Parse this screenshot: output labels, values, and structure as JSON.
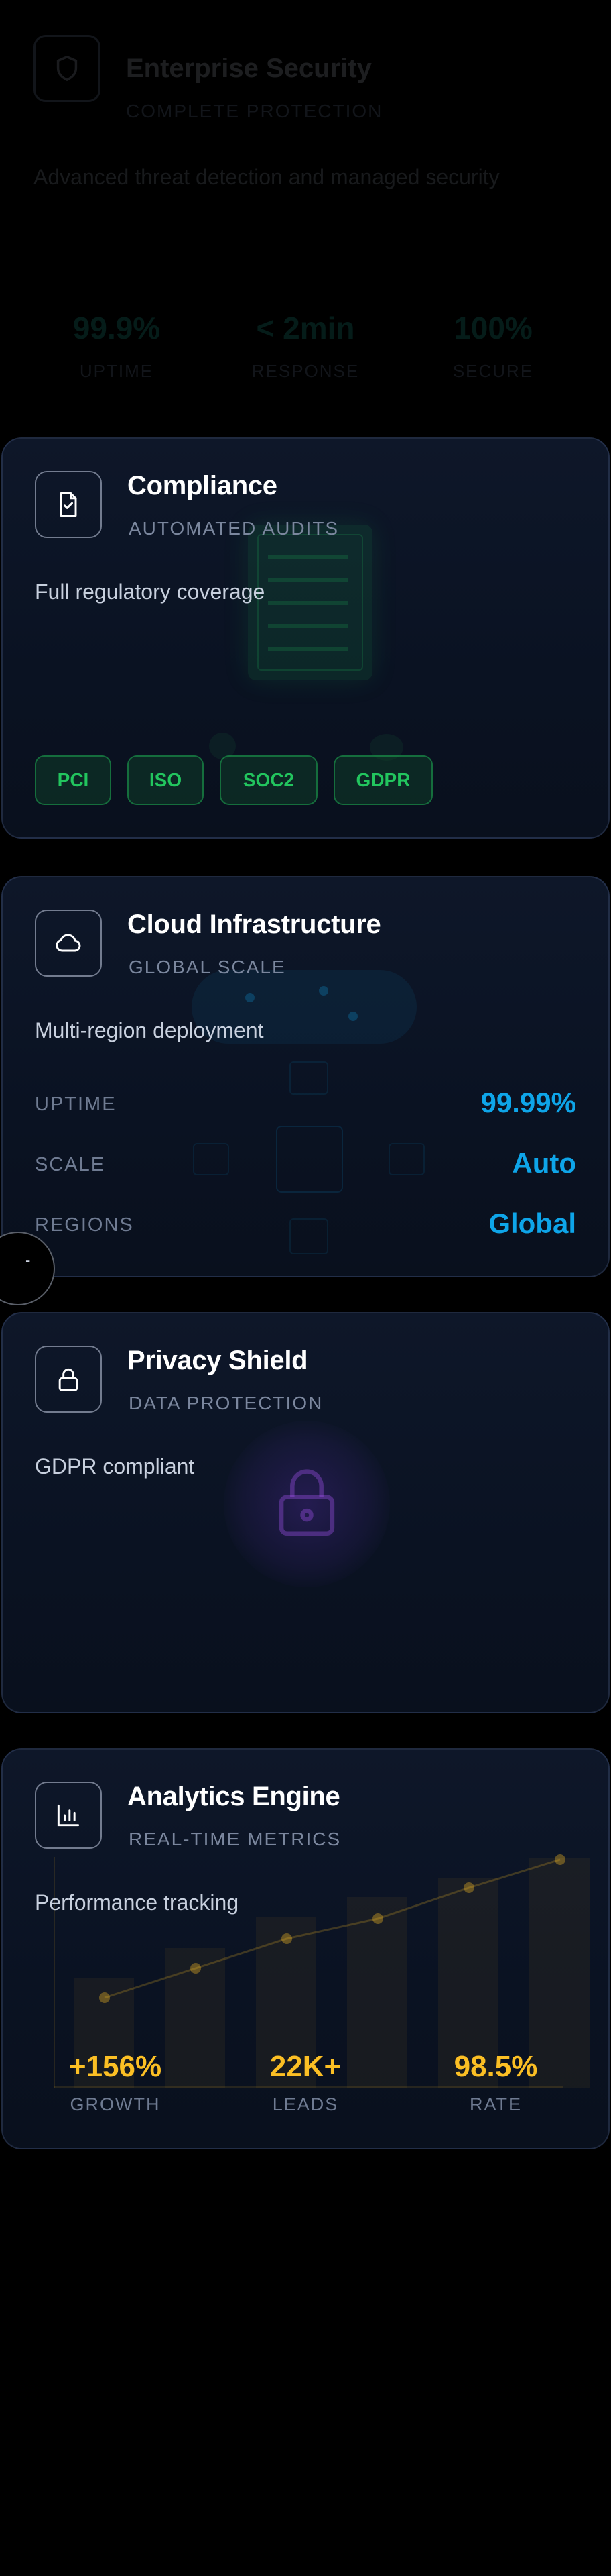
{
  "hidden_card": {
    "title": "Enterprise Security",
    "subtitle": "COMPLETE PROTECTION",
    "description": "Advanced threat detection and managed security",
    "stats": [
      {
        "value": "99.9%",
        "label": "UPTIME"
      },
      {
        "value": "< 2min",
        "label": "RESPONSE"
      },
      {
        "value": "100%",
        "label": "SECURE"
      }
    ]
  },
  "compliance": {
    "title": "Compliance",
    "subtitle": "AUTOMATED AUDITS",
    "description": "Full regulatory coverage",
    "tags": [
      "PCI",
      "ISO",
      "SOC2",
      "GDPR"
    ],
    "icon": "file-check-icon",
    "accent": "#22c55e"
  },
  "cloud": {
    "title": "Cloud Infrastructure",
    "subtitle": "GLOBAL SCALE",
    "description": "Multi-region deployment",
    "metrics": [
      {
        "label": "UPTIME",
        "value": "99.99%"
      },
      {
        "label": "SCALE",
        "value": "Auto"
      },
      {
        "label": "REGIONS",
        "value": "Global"
      }
    ],
    "icon": "cloud-icon",
    "accent": "#0ea5e9"
  },
  "privacy": {
    "title": "Privacy Shield",
    "subtitle": "DATA PROTECTION",
    "description": "GDPR compliant",
    "icon": "lock-icon",
    "accent": "#7c3aed"
  },
  "analytics": {
    "title": "Analytics Engine",
    "subtitle": "REAL-TIME METRICS",
    "description": "Performance tracking",
    "stats": [
      {
        "value": "+156%",
        "label": "GROWTH"
      },
      {
        "value": "22K+",
        "label": "LEADS"
      },
      {
        "value": "98.5%",
        "label": "RATE"
      }
    ],
    "icon": "bar-chart-icon",
    "accent": "#fbbf24"
  },
  "floating_button": {
    "glyph": "-"
  }
}
